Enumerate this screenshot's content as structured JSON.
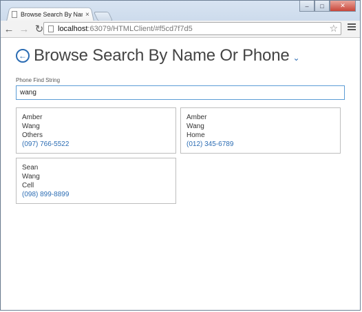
{
  "browser": {
    "tab_title": "Browse Search By Name O",
    "tab_close": "×",
    "url_host": "localhost",
    "url_rest": ":63079/HTMLClient/#f5cd7f7d5",
    "window_buttons": {
      "minimize": "–",
      "maximize": "□",
      "close": "✕"
    }
  },
  "page": {
    "title": "Browse Search By Name Or Phone",
    "search": {
      "label": "Phone Find String",
      "value": "wang"
    },
    "results": [
      {
        "first": "Amber",
        "last": "Wang",
        "type": "Others",
        "phone": "(097) 766-5522"
      },
      {
        "first": "Amber",
        "last": "Wang",
        "type": "Home",
        "phone": "(012) 345-6789"
      },
      {
        "first": "Sean",
        "last": "Wang",
        "type": "Cell",
        "phone": "(098) 899-8899"
      }
    ]
  },
  "colors": {
    "accent": "#2b6cb3",
    "input_border": "#5a9bd5"
  }
}
